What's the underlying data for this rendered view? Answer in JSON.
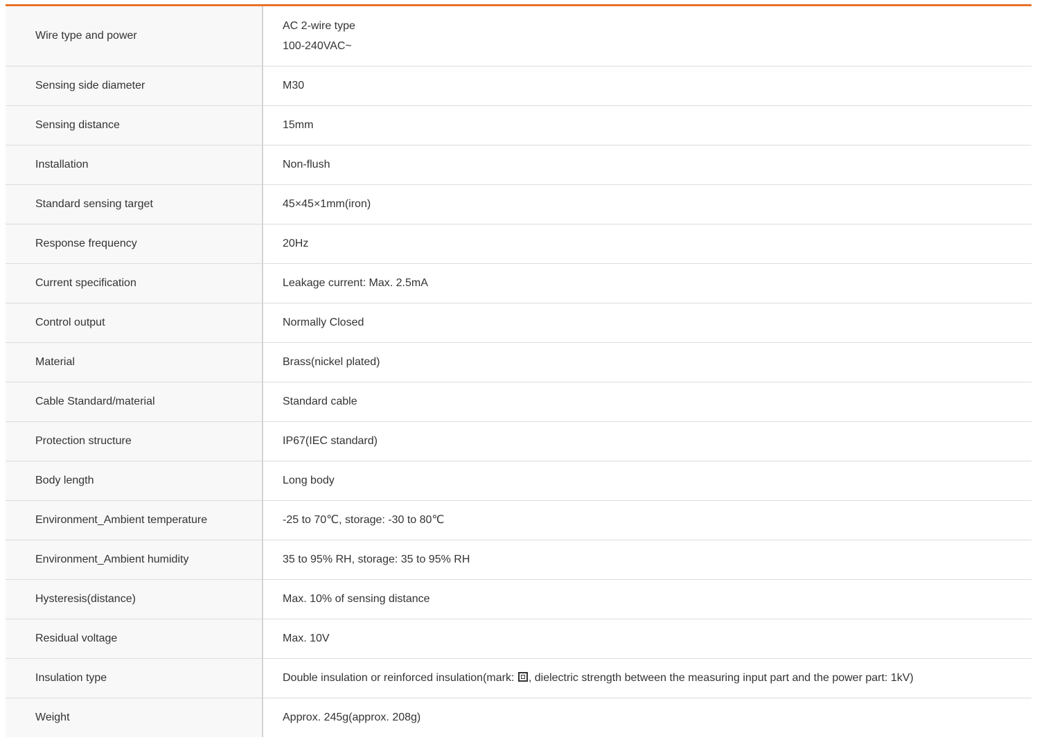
{
  "rows": [
    {
      "label": "Wire type and power",
      "value_lines": [
        "AC 2-wire type",
        "100-240VAC~"
      ]
    },
    {
      "label": "Sensing side diameter",
      "value": "M30"
    },
    {
      "label": "Sensing distance",
      "value": "15mm"
    },
    {
      "label": "Installation",
      "value": "Non-flush"
    },
    {
      "label": "Standard sensing target",
      "value": "45×45×1mm(iron)"
    },
    {
      "label": "Response frequency",
      "value": "20Hz"
    },
    {
      "label": "Current specification",
      "value": "Leakage current: Max. 2.5mA"
    },
    {
      "label": "Control output",
      "value": "Normally Closed"
    },
    {
      "label": "Material",
      "value": "Brass(nickel plated)"
    },
    {
      "label": "Cable Standard/material",
      "value": "Standard cable"
    },
    {
      "label": "Protection structure",
      "value": "IP67(IEC standard)"
    },
    {
      "label": "Body length",
      "value": "Long body"
    },
    {
      "label": "Environment_Ambient temperature",
      "value": "-25 to 70℃, storage: -30 to 80℃"
    },
    {
      "label": "Environment_Ambient humidity",
      "value": "35 to 95% RH, storage: 35 to 95% RH"
    },
    {
      "label": "Hysteresis(distance)",
      "value": "Max. 10% of sensing distance"
    },
    {
      "label": "Residual voltage",
      "value": "Max. 10V"
    },
    {
      "label": "Insulation type",
      "value_before_icon": "Double insulation or reinforced insulation(mark: ",
      "value_after_icon": ", dielectric strength between the measuring input part and the power part: 1kV)",
      "icon": "double-square-icon"
    },
    {
      "label": "Weight",
      "value": "Approx. 245g(approx. 208g)"
    }
  ],
  "colors": {
    "accent": "#e8712a",
    "label_bg": "#f8f8f8",
    "border": "#dcdcdc",
    "text": "#333333"
  }
}
